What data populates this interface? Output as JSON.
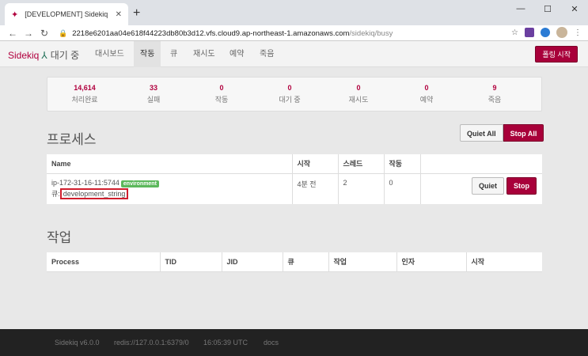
{
  "browser": {
    "tab_title": "[DEVELOPMENT] Sidekiq",
    "new_tab": "+",
    "url_host": "2218e6201aa04e618f44223db80b3d12.vfs.cloud9.ap-northeast-1.amazonaws.com",
    "url_path": "/sidekiq/busy"
  },
  "nav": {
    "brand": "Sidekiq",
    "status": "대기 중",
    "items": [
      "대시보드",
      "작동",
      "큐",
      "재시도",
      "예약",
      "죽음"
    ],
    "poll_label": "폴링 시작"
  },
  "stats": [
    {
      "value": "14,614",
      "label": "처리완료"
    },
    {
      "value": "33",
      "label": "실패"
    },
    {
      "value": "0",
      "label": "작동"
    },
    {
      "value": "0",
      "label": "대기 중"
    },
    {
      "value": "0",
      "label": "재시도"
    },
    {
      "value": "0",
      "label": "예약"
    },
    {
      "value": "9",
      "label": "죽음"
    }
  ],
  "processes": {
    "title": "프로세스",
    "quiet_all": "Quiet All",
    "stop_all": "Stop All",
    "headers": [
      "Name",
      "시작",
      "스레드",
      "작동"
    ],
    "row": {
      "name": "ip-172-31-16-11:5744",
      "tag": "environment",
      "queue_label": "큐:",
      "queue": "development_string",
      "started": "4분 전",
      "threads": "2",
      "busy": "0",
      "quiet": "Quiet",
      "stop": "Stop"
    }
  },
  "jobs": {
    "title": "작업",
    "headers": [
      "Process",
      "TID",
      "JID",
      "큐",
      "작업",
      "인자",
      "시작"
    ]
  },
  "footer": {
    "version": "Sidekiq v6.0.0",
    "redis": "redis://127.0.0.1:6379/0",
    "time": "16:05:39 UTC",
    "docs": "docs"
  }
}
